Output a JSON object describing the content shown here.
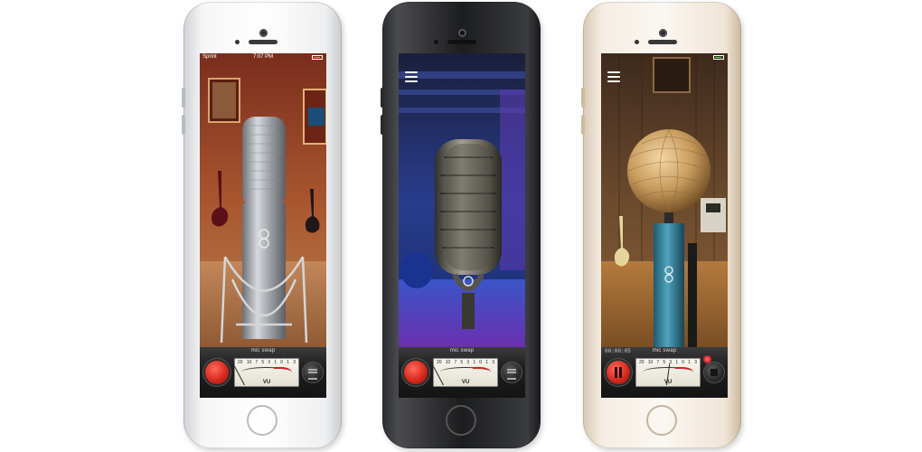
{
  "phones": [
    {
      "color_name": "silver",
      "status_bar": {
        "carrier": "Sprint",
        "time": "7:07 PM"
      },
      "brand_label": "mic swap",
      "meter": {
        "scale": [
          "20",
          "10",
          "7",
          "5",
          "3",
          "1",
          "0",
          "1",
          "3"
        ],
        "unit": "VU"
      },
      "mic_icon": "condenser-microphone-icon",
      "background_scene": "recording-studio"
    },
    {
      "color_name": "space-gray",
      "brand_label": "mic swap",
      "meter": {
        "scale": [
          "20",
          "10",
          "7",
          "5",
          "3",
          "1",
          "0",
          "1",
          "3"
        ],
        "unit": "VU"
      },
      "mic_icon": "vintage-ribbon-microphone-icon",
      "background_scene": "stage-with-blue-lights"
    },
    {
      "color_name": "gold",
      "timecode": "00:00:05",
      "brand_label": "mic swap",
      "meter": {
        "scale": [
          "20",
          "10",
          "7",
          "5",
          "3",
          "1",
          "0",
          "1",
          "3"
        ],
        "unit": "VU"
      },
      "mic_icon": "ball-microphone-icon",
      "background_scene": "wood-studio"
    }
  ],
  "colors": {
    "record_red": "#d9281c",
    "clip_led": "#e01010",
    "meter_face": "#f4f1e6",
    "battery_green": "#3ddc4a"
  }
}
